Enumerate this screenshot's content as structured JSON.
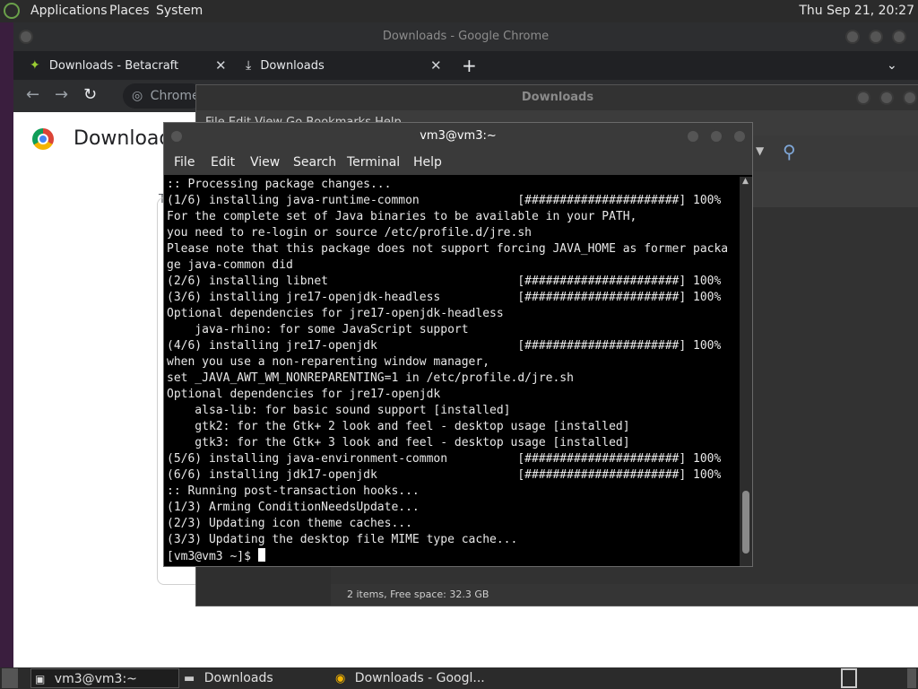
{
  "top_panel": {
    "menus": [
      "Applications",
      "Places",
      "System"
    ],
    "clock": "Thu Sep 21, 20:27"
  },
  "chrome": {
    "title": "Downloads - Google Chrome",
    "tabs": [
      {
        "label": "Downloads - Betacraft",
        "icon": "betacraft-icon"
      },
      {
        "label": "Downloads",
        "icon": "download-icon"
      }
    ],
    "new_tab": "+",
    "omnibox_label": "Chrome",
    "page_heading": "Download",
    "page_letter": "T"
  },
  "file_manager": {
    "title": "Downloads",
    "menu_partial": "File   Edit   View   Go   Bookmarks   Help",
    "status": "2 items, Free space: 32.3 GB"
  },
  "terminal": {
    "title": "vm3@vm3:~",
    "menus": [
      "File",
      "Edit",
      "View",
      "Search",
      "Terminal",
      "Help"
    ],
    "lines": [
      ":: Processing package changes...",
      "(1/6) installing java-runtime-common              [######################] 100%",
      "For the complete set of Java binaries to be available in your PATH,",
      "you need to re-login or source /etc/profile.d/jre.sh",
      "Please note that this package does not support forcing JAVA_HOME as former packa",
      "ge java-common did",
      "(2/6) installing libnet                           [######################] 100%",
      "(3/6) installing jre17-openjdk-headless           [######################] 100%",
      "Optional dependencies for jre17-openjdk-headless",
      "    java-rhino: for some JavaScript support",
      "(4/6) installing jre17-openjdk                    [######################] 100%",
      "when you use a non-reparenting window manager,",
      "set _JAVA_AWT_WM_NONREPARENTING=1 in /etc/profile.d/jre.sh",
      "Optional dependencies for jre17-openjdk",
      "    alsa-lib: for basic sound support [installed]",
      "    gtk2: for the Gtk+ 2 look and feel - desktop usage [installed]",
      "    gtk3: for the Gtk+ 3 look and feel - desktop usage [installed]",
      "(5/6) installing java-environment-common          [######################] 100%",
      "(6/6) installing jdk17-openjdk                    [######################] 100%",
      ":: Running post-transaction hooks...",
      "(1/3) Arming ConditionNeedsUpdate...",
      "(2/3) Updating icon theme caches...",
      "(3/3) Updating the desktop file MIME type cache..."
    ],
    "prompt": "[vm3@vm3 ~]$ "
  },
  "taskbar": {
    "items": [
      {
        "label": "vm3@vm3:~",
        "icon": "terminal-icon"
      },
      {
        "label": "Downloads",
        "icon": "folder-icon"
      },
      {
        "label": "Downloads - Googl...",
        "icon": "chrome-icon"
      }
    ]
  }
}
